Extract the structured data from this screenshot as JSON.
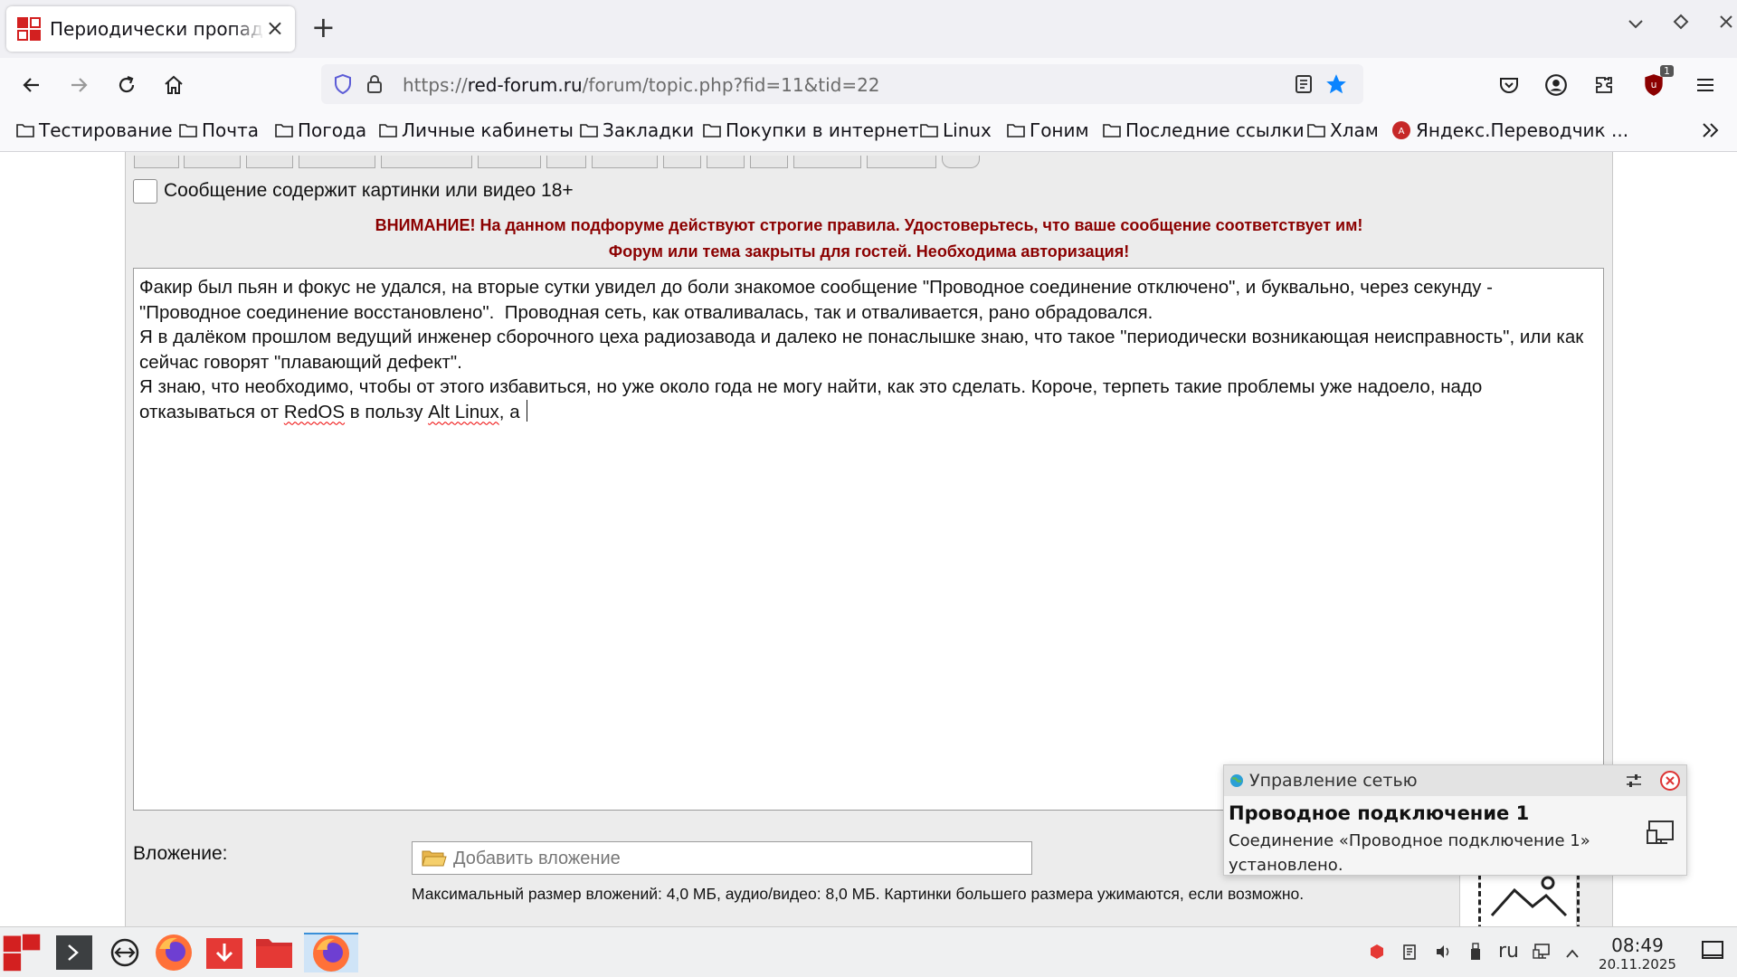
{
  "tab": {
    "title": "Периодически пропадает",
    "close": "×"
  },
  "newtab": "+",
  "nav": {
    "url_prefix": "https://",
    "url_host": "red-forum.ru",
    "url_path": "/forum/topic.php?fid=11&tid=22",
    "ext_badge": "1"
  },
  "bookmarks": [
    "Тестирование",
    "Почта",
    "Погода",
    "Личные кабинеты",
    "Закладки",
    "Покупки в интернет",
    "Linux",
    "Гоним",
    "Последние ссылки",
    "Хлам",
    "Яндекс.Переводчик ..."
  ],
  "form": {
    "nsfw_label": "Сообщение содержит картинки или видео 18+",
    "warning1": "ВНИМАНИЕ! На данном подфоруме действуют строгие правила. Удостоверьтесь, что ваше сообщение соответствует им!",
    "warning2": "Форум или тема закрыты для гостей. Необходима авторизация!",
    "message": {
      "p1": "Факир был пьян и фокус не удался, на вторые сутки увидел до боли знакомое сообщение \"Проводное соединение отключено\", и буквально, через секунду - \"Проводное соединение восстановлено\".  Проводная сеть, как отваливалась, так и отваливается, рано обрадовался.",
      "p2": "Я в далёком прошлом ведущий инженер сборочного цеха радиозавода и далеко не понаслышке знаю, что такое \"периодически возникающая неисправность\", или как сейчас говорят \"плавающий дефект\".",
      "p3a": "Я знаю, что необходимо, чтобы от этого избавиться, но уже около года не могу найти, как это сделать. Короче, терпеть такие проблемы уже надоело, надо отказываться от ",
      "p3b": "RedOS",
      "p3c": " в пользу ",
      "p3d": "Alt Linux",
      "p3e": ", а "
    },
    "attachment_label": "Вложение:",
    "attachment_placeholder": "Добавить вложение",
    "attachment_note": "Максимальный размер вложений: 4,0 МБ, аудио/видео: 8,0 МБ. Картинки большего размера ужимаются, если возможно."
  },
  "notification": {
    "app": "Управление сетью",
    "title": "Проводное подключение 1",
    "body": "Соединение «Проводное подключение 1» установлено."
  },
  "taskbar": {
    "lang": "ru",
    "time": "08:49",
    "date": "20.11.2025"
  },
  "colors": {
    "warning": "#8b0000",
    "bookmark_star": "#0a84ff",
    "ext_badge": "#c00000"
  }
}
